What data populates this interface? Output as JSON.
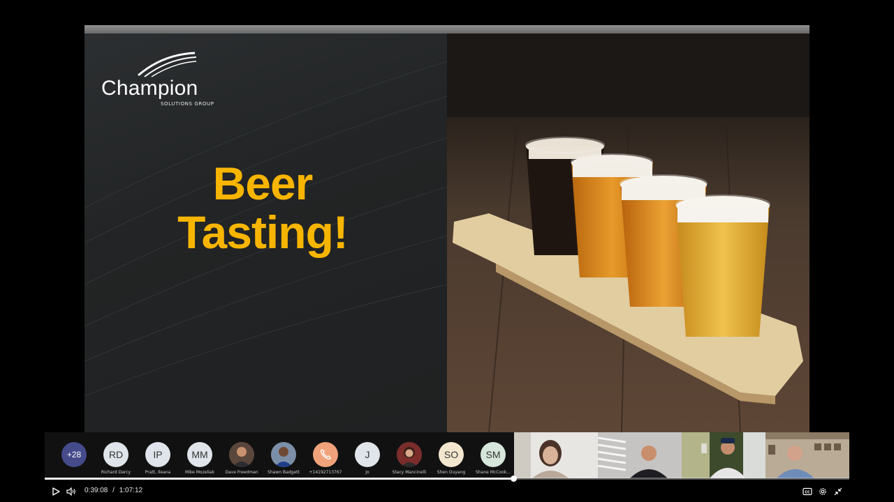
{
  "slide": {
    "logo_word": "Champion",
    "logo_sub": "SOLUTIONS GROUP",
    "title_line1": "Beer",
    "title_line2": "Tasting!"
  },
  "participants": {
    "more_count": "+28",
    "people": [
      {
        "initials": "RD",
        "name": "Richard Darcy",
        "style": "plain"
      },
      {
        "initials": "IP",
        "name": "Pratt, Ileana",
        "style": "plain"
      },
      {
        "initials": "MM",
        "name": "Mike Mozeliak",
        "style": "plain"
      },
      {
        "initials": "",
        "name": "Dave Freedman",
        "style": "photo"
      },
      {
        "initials": "",
        "name": "Shawn Badgett",
        "style": "photo"
      },
      {
        "initials": "",
        "name": "+14192713767",
        "style": "orange"
      },
      {
        "initials": "J",
        "name": "Jo",
        "style": "plain"
      },
      {
        "initials": "",
        "name": "Stacy Mancinelli",
        "style": "photo"
      },
      {
        "initials": "SO",
        "name": "Shen Ouyang",
        "style": "cream"
      },
      {
        "initials": "SM",
        "name": "Shane McCook...",
        "style": "mint"
      }
    ]
  },
  "player": {
    "current_time": "0:39:08",
    "separator": "/",
    "duration": "1:07:12",
    "progress_fraction": 0.5825,
    "icons": [
      "play-icon",
      "volume-icon",
      "captions-icon",
      "settings-icon",
      "collapse-icon"
    ]
  },
  "colors": {
    "title_yellow": "#f7b500",
    "avatar_more": "#444a8a"
  }
}
